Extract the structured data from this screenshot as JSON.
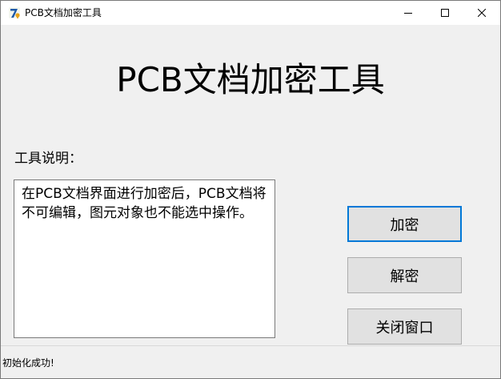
{
  "window": {
    "title": "PCB文档加密工具",
    "icon": "app-icon",
    "controls": [
      "minimize-icon",
      "maximize-icon",
      "close-icon"
    ]
  },
  "main": {
    "heading": "PCB文档加密工具",
    "description_label": "工具说明：",
    "description_text": "在PCB文档界面进行加密后，PCB文档将不可编辑，图元对象也不能选中操作。"
  },
  "buttons": {
    "encrypt": "加密",
    "decrypt": "解密",
    "close_window": "关闭窗口"
  },
  "status_bar": {
    "text": "初始化成功!"
  },
  "colors": {
    "focus_border": "#0078d7",
    "window_bg": "#f0f0f0"
  }
}
